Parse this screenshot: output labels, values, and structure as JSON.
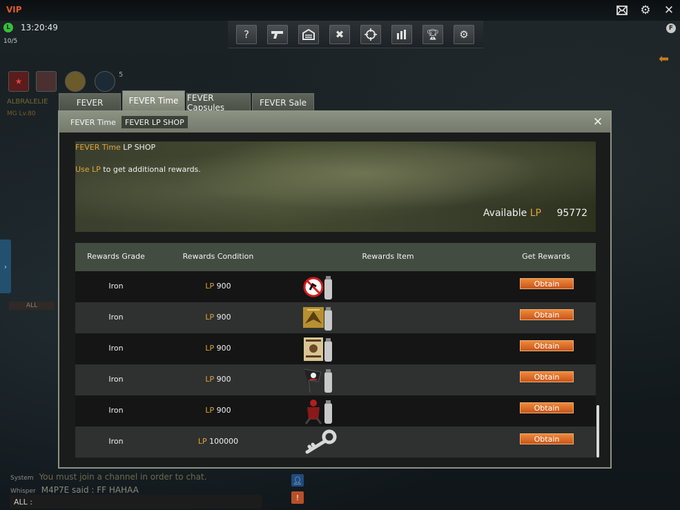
{
  "window": {
    "vip_label": "VIP",
    "clock": "13:20:49",
    "counter": "10/5",
    "f_badge": "F"
  },
  "player": {
    "name": "ALBRALELIE",
    "level": "MG Lv.80",
    "count": "5",
    "channel_badge": "ALL"
  },
  "top_icons": [
    "mail-icon",
    "gear-icon",
    "close-icon"
  ],
  "menu_icons": [
    "help-icon",
    "pistol-icon",
    "garage-icon",
    "tools-icon",
    "crosshair-icon",
    "stats-icon",
    "trophy-icon",
    "settings-icon"
  ],
  "tabs": [
    {
      "label": "FEVER",
      "active": false
    },
    {
      "label": "FEVER Time",
      "active": true
    },
    {
      "label": "FEVER Capsules",
      "active": false
    },
    {
      "label": "FEVER Sale",
      "active": false
    }
  ],
  "subtabs": [
    {
      "label": "FEVER Time",
      "active": false
    },
    {
      "label": "FEVER  LP SHOP",
      "active": true
    }
  ],
  "banner": {
    "title_prefix": "FEVER Time",
    "title_suffix": " LP SHOP",
    "desc_prefix": "Use LP",
    "desc_suffix": " to get additional rewards.",
    "available_label": "Available",
    "available_unit": "LP",
    "available_value": "95772"
  },
  "table": {
    "headers": [
      "Rewards Grade",
      "Rewards Condition",
      "Rewards Item",
      "Get Rewards"
    ],
    "rows": [
      {
        "grade": "Iron",
        "unit": "LP",
        "cost": "900",
        "item": "no-entry-spray-item",
        "button": "Obtain"
      },
      {
        "grade": "Iron",
        "unit": "LP",
        "cost": "900",
        "item": "golden-eagle-spray-item",
        "button": "Obtain"
      },
      {
        "grade": "Iron",
        "unit": "LP",
        "cost": "900",
        "item": "wanted-poster-spray-item",
        "button": "Obtain"
      },
      {
        "grade": "Iron",
        "unit": "LP",
        "cost": "900",
        "item": "pirate-flag-spray-item",
        "button": "Obtain"
      },
      {
        "grade": "Iron",
        "unit": "LP",
        "cost": "900",
        "item": "red-warrior-spray-item",
        "button": "Obtain"
      },
      {
        "grade": "Iron",
        "unit": "LP",
        "cost": "100000",
        "item": "key-item",
        "button": "Obtain"
      }
    ]
  },
  "chat": {
    "system_type": "System",
    "system_msg": "You must join a channel in order to chat.",
    "whisper_type": "Whisper",
    "whisper_msg": "M4P7E said : FF HAHAA",
    "input_prefix": "ALL :"
  },
  "colors": {
    "accent_gold": "#e2a43a",
    "button_orange": "#e0732a",
    "clock_green": "#35c23a",
    "vip_orange": "#e25a2a"
  }
}
